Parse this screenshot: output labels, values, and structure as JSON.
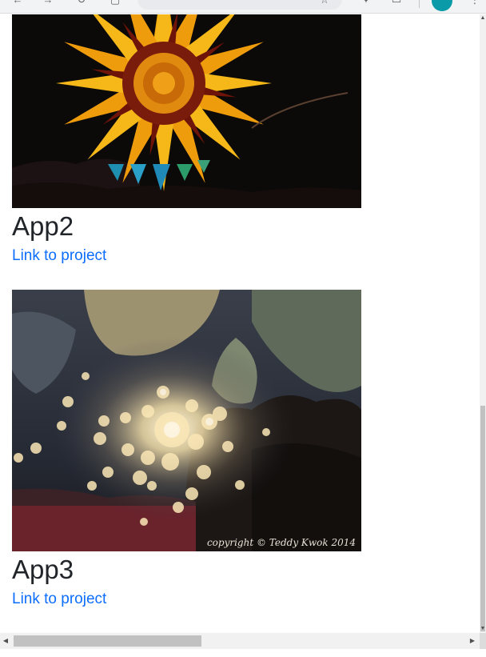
{
  "toolbar": {
    "back_icon": "back-arrow-icon",
    "forward_icon": "forward-arrow-icon",
    "reload_icon": "reload-icon",
    "page_icon": "page-icon",
    "extension_icon": "extension-puzzle-icon",
    "bookmark_icon": "star-icon",
    "menu_icon": "kebab-menu-icon"
  },
  "projects": [
    {
      "title": "App2",
      "link_label": "Link to project",
      "image_subject": "sunflower"
    },
    {
      "title": "App3",
      "link_label": "Link to project",
      "image_subject": "bokeh-sunlight-through-trees",
      "image_caption": "copyright © Teddy Kwok 2014"
    }
  ],
  "colors": {
    "link": "#0d6efd",
    "heading": "#212529",
    "scrollbar_track": "#f1f1f1",
    "scrollbar_thumb": "#c1c1c1",
    "avatar": "#0b9aa8"
  }
}
